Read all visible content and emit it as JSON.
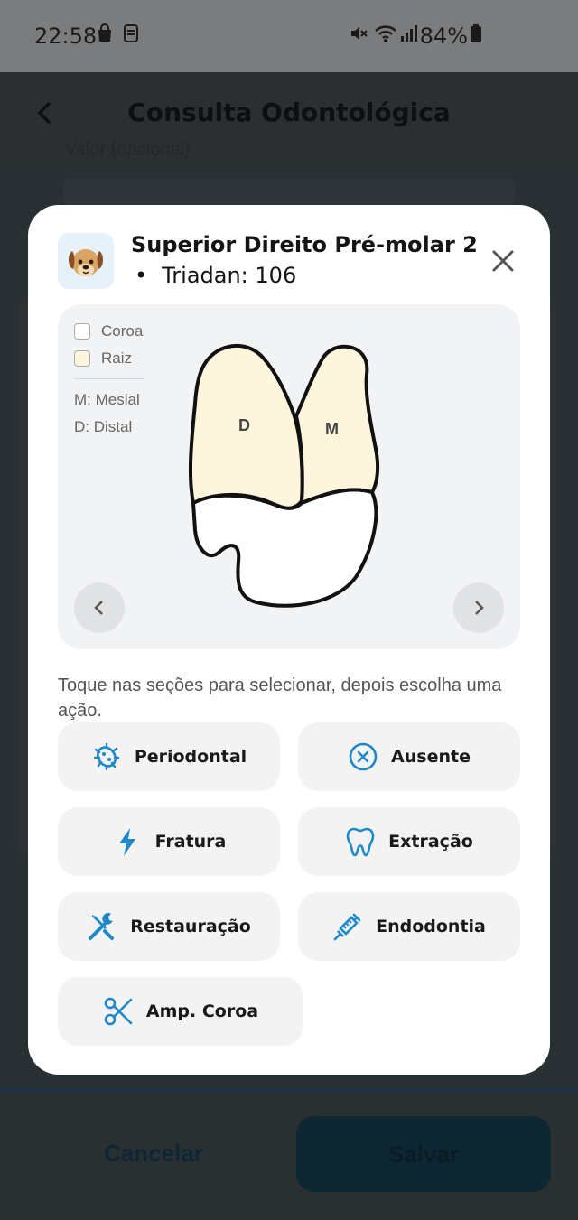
{
  "status_bar": {
    "time": "22:58",
    "battery": "84%"
  },
  "header": {
    "title": "Consulta Odontológica"
  },
  "background": {
    "field_label": "Valor (opcional)",
    "cancel_label": "Cancelar",
    "save_label": "Salvar"
  },
  "modal": {
    "title": "Superior Direito Pré-molar 2",
    "subtitle": "Triadan: 106",
    "legend": {
      "crown": "Coroa",
      "root": "Raiz",
      "mesial": "M: Mesial",
      "distal": "D: Distal"
    },
    "tooth_labels": {
      "distal": "D",
      "mesial": "M"
    },
    "instruction": "Toque nas seções para selecionar, depois escolha uma ação.",
    "actions": [
      {
        "label": "Periodontal",
        "icon": "bacteria-icon"
      },
      {
        "label": "Ausente",
        "icon": "x-circle-icon"
      },
      {
        "label": "Fratura",
        "icon": "lightning-icon"
      },
      {
        "label": "Extração",
        "icon": "tooth-icon"
      },
      {
        "label": "Restauração",
        "icon": "tools-icon"
      },
      {
        "label": "Endodontia",
        "icon": "syringe-icon"
      },
      {
        "label": "Amp. Coroa",
        "icon": "scissors-icon"
      }
    ]
  },
  "colors": {
    "accent": "#1e88c8",
    "crown_fill": "#fdf6dc",
    "button_bg": "#f3f3f4"
  }
}
